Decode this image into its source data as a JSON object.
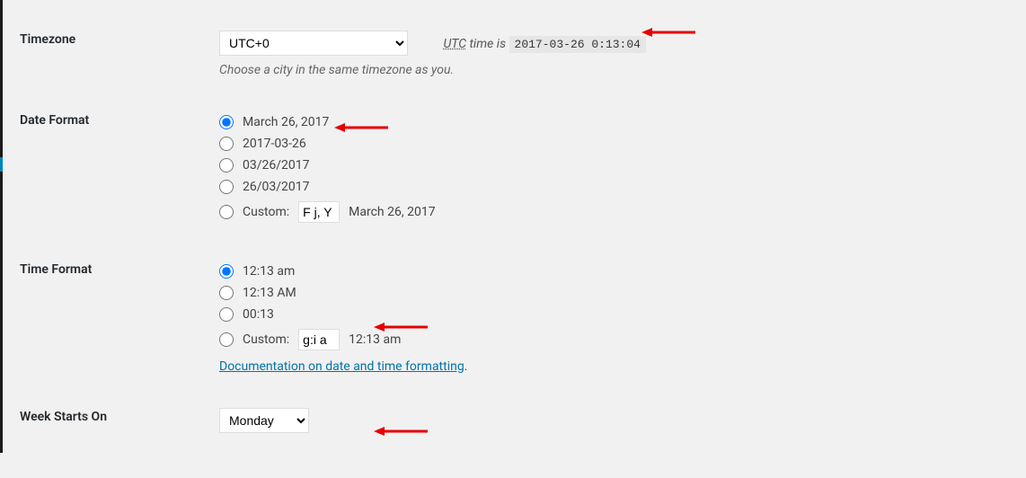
{
  "timezone": {
    "label": "Timezone",
    "value": "UTC+0",
    "utc_abbr": "UTC",
    "time_is": " time is ",
    "time_value": "2017-03-26 0:13:04",
    "desc": "Choose a city in the same timezone as you."
  },
  "date_format": {
    "label": "Date Format",
    "options": [
      "March 26, 2017",
      "2017-03-26",
      "03/26/2017",
      "26/03/2017"
    ],
    "selected": 0,
    "custom_label": "Custom:",
    "custom_value": "F j, Y",
    "custom_example": "March 26, 2017"
  },
  "time_format": {
    "label": "Time Format",
    "options": [
      "12:13 am",
      "12:13 AM",
      "00:13"
    ],
    "selected": 0,
    "custom_label": "Custom:",
    "custom_value": "g:i a",
    "custom_example": "12:13 am",
    "doc_link": "Documentation on date and time formatting"
  },
  "week_starts": {
    "label": "Week Starts On",
    "value": "Monday"
  }
}
